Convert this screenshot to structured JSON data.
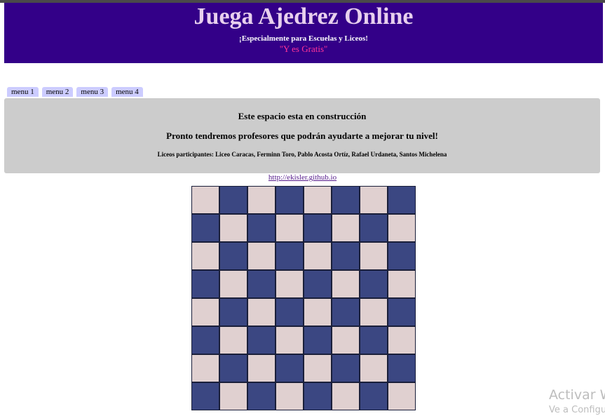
{
  "header": {
    "title": "Juega Ajedrez Online",
    "subtitle": "¡Especialmente para Escuelas y Liceos!",
    "tagline": "\"Y es Gratis\""
  },
  "menu": {
    "items": [
      {
        "label": "menu 1"
      },
      {
        "label": "menu 2"
      },
      {
        "label": "menu 3"
      },
      {
        "label": "menu 4"
      }
    ]
  },
  "notice": {
    "line1": "Este espacio esta en construcción",
    "line2": "Pronto tendremos profesores que podrán ayudarte a mejorar tu nivel!",
    "line3": "Liceos participantes: Liceo Caracas, Ferminn Toro, Pablo Acosta Ortíz, Rafael Urdaneta, Santos Michelena"
  },
  "link": {
    "text": "http://ekisler.github.io"
  },
  "board": {
    "rows": 8,
    "cols": 8,
    "light_color": "#e0d0d0",
    "dark_color": "#3b4782"
  },
  "watermark": {
    "line1": "Activar W",
    "line2": "Ve a Configu"
  },
  "colors": {
    "header_bg": "#330088",
    "title": "#e8d0ee",
    "tagline": "#ff3399",
    "menu_bg": "#ccccff",
    "notice_bg": "#cccccc"
  }
}
